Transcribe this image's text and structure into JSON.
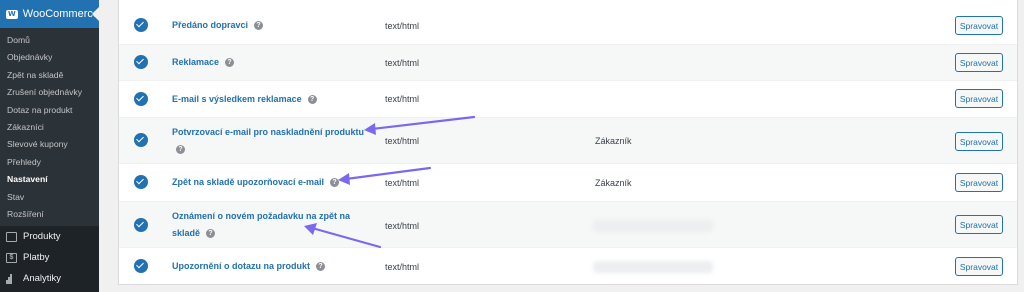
{
  "sidebar": {
    "header": "WooCommerce",
    "sub_items": [
      "Domů",
      "Objednávky",
      "Zpět na skladě",
      "Zrušení objednávky",
      "Dotaz na produkt",
      "Zákazníci",
      "Slevové kupony",
      "Přehledy",
      "Nastavení",
      "Stav",
      "Rozšíření"
    ],
    "active_item": "Nastavení",
    "main_items": [
      "Produkty",
      "Platby",
      "Analytiky"
    ]
  },
  "emails": {
    "manage_label": "Spravovat",
    "rows": [
      {
        "name": "Předáno dopravci",
        "content_type": "text/html",
        "recipient": ""
      },
      {
        "name": "Reklamace",
        "content_type": "text/html",
        "recipient": ""
      },
      {
        "name": "E-mail s výsledkem reklamace",
        "content_type": "text/html",
        "recipient": ""
      },
      {
        "name": "Potvrzovací e-mail pro naskladnění produktu",
        "content_type": "text/html",
        "recipient": "Zákazník"
      },
      {
        "name": "Zpět na skladě upozorňovací e-mail",
        "content_type": "text/html",
        "recipient": "Zákazník"
      },
      {
        "name": "Oznámení o novém požadavku na zpět na skladě",
        "content_type": "text/html",
        "recipient": "[blurred]"
      },
      {
        "name": "Upozornění o dotazu na produkt",
        "content_type": "text/html",
        "recipient": "[blurred]"
      }
    ]
  },
  "colors": {
    "accent": "#2271b1",
    "annotation_arrow": "#7b68ee"
  },
  "icons": [
    "woocommerce-logo-icon",
    "products-icon",
    "payments-icon",
    "analytics-icon",
    "check-icon",
    "help-icon"
  ]
}
